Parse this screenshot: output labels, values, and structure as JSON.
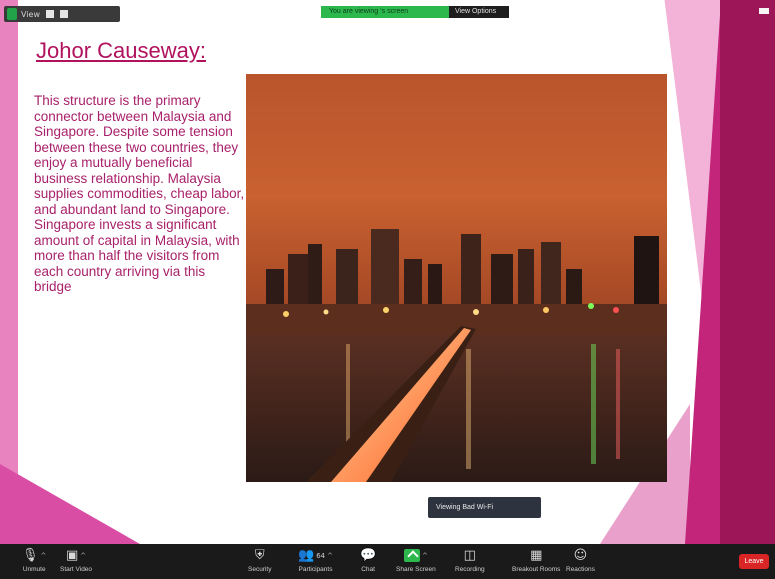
{
  "slide": {
    "title": "Johor Causeway:",
    "body": "This structure is the primary connector between Malaysia and Singapore. Despite some tension between these two countries, they enjoy a mutually beneficial business relationship. Malaysia supplies commodities, cheap labor, and abundant land to Singapore. Singapore invests a significant amount of capital in Malaysia, with more than half the visitors from each country arriving via this bridge",
    "image_alt": "Johor Causeway at night with city skyline"
  },
  "meeting_bar": {
    "info_text": "View",
    "icon": "shield-icon"
  },
  "banner": {
    "viewing": "You are viewing ‘s screen",
    "options": "View Options"
  },
  "tooltip": "Viewing Bad Wi-Fi",
  "toolbar": {
    "items": [
      {
        "label": "Unmute",
        "icon": "microphone-muted-icon"
      },
      {
        "label": "Start Video",
        "icon": "video-off-icon"
      },
      {
        "label": "Security",
        "icon": "shield-icon"
      },
      {
        "label": "Participants",
        "icon": "participants-icon"
      },
      {
        "label": "Chat",
        "icon": "chat-icon"
      },
      {
        "label": "Share Screen",
        "icon": "share-screen-icon"
      },
      {
        "label": "Recording",
        "icon": "record-icon"
      },
      {
        "label": "Breakout Rooms",
        "icon": "breakout-rooms-icon"
      },
      {
        "label": "Reactions",
        "icon": "reactions-icon"
      }
    ],
    "participant_count": "64",
    "end_label": "Leave"
  },
  "colors": {
    "title": "#b0125e",
    "body": "#a8216a",
    "share_green": "#2db84d",
    "end_red": "#d92525"
  }
}
